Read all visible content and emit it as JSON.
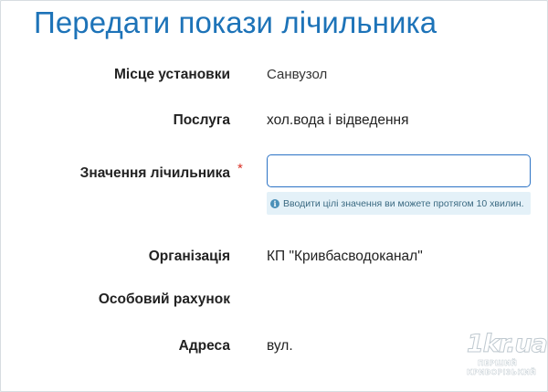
{
  "header": {
    "title": "Передати покази лічильника"
  },
  "form": {
    "location": {
      "label": "Місце установки",
      "value": "Санвузол"
    },
    "service": {
      "label": "Послуга",
      "value": "хол.вода і відведення"
    },
    "meter_value": {
      "label": "Значення лічильника",
      "required_mark": "*",
      "value": "",
      "placeholder": "",
      "hint": "Вводити цілі значення ви можете протягом 10 хвилин."
    },
    "organization": {
      "label": "Організація",
      "value": "КП \"Кривбасводоканал\""
    },
    "account": {
      "label": "Особовий рахунок",
      "value": ""
    },
    "address": {
      "label": "Адреса",
      "value": "вул."
    }
  },
  "watermark": {
    "main": "1kr.ua",
    "line1": "ПЕРШИЙ",
    "line2": "КРИВОРІЗЬКИЙ"
  },
  "icons": {
    "hint_icon": "info-icon"
  }
}
